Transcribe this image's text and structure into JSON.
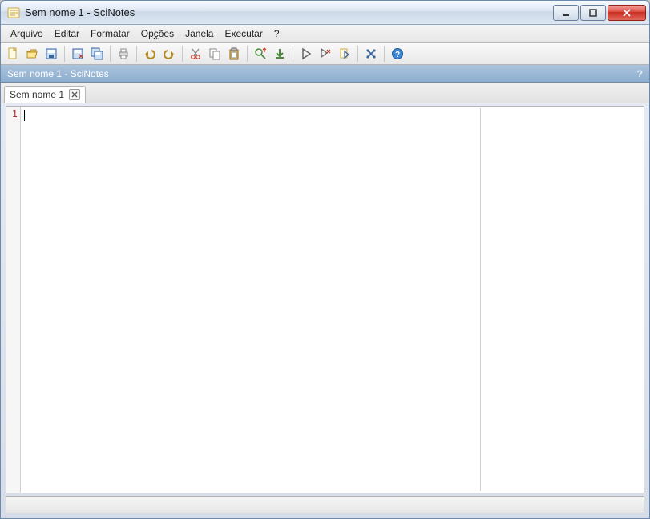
{
  "window": {
    "title": "Sem nome 1 - SciNotes"
  },
  "menu": {
    "arquivo": "Arquivo",
    "editar": "Editar",
    "formatar": "Formatar",
    "opcoes": "Opções",
    "janela": "Janela",
    "executar": "Executar",
    "help": "?"
  },
  "subheader": {
    "text": "Sem nome 1 - SciNotes",
    "help_glyph": "?"
  },
  "tab": {
    "label": "Sem nome 1"
  },
  "editor": {
    "line_number": "1",
    "content": ""
  }
}
